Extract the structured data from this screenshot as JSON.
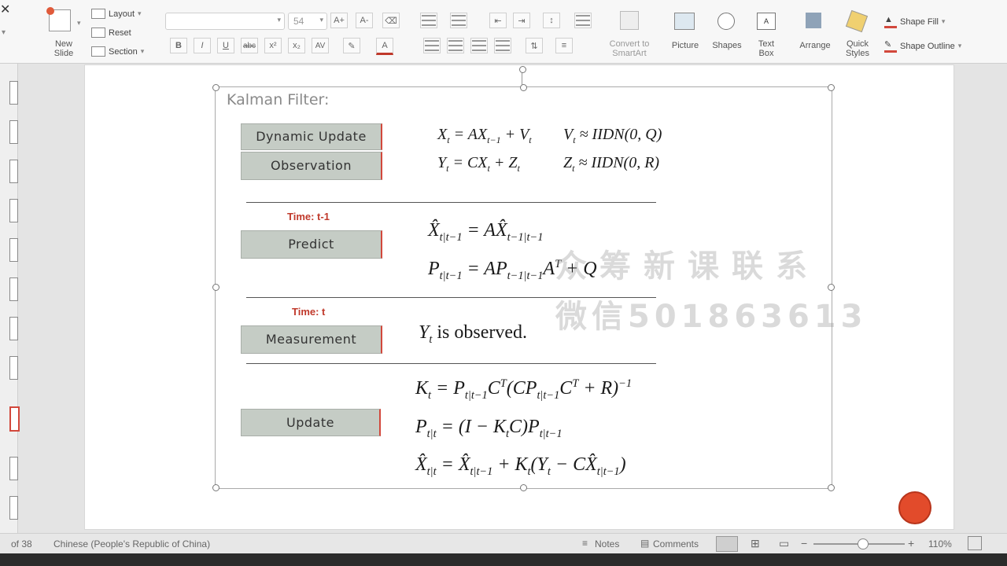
{
  "ribbon": {
    "new_slide": "New\nSlide",
    "layout": "Layout",
    "reset": "Reset",
    "section": "Section",
    "font_size": "54",
    "bold": "B",
    "italic": "I",
    "underline": "U",
    "strike": "abc",
    "superscript": "x²",
    "subscript": "x₂",
    "char_spacing": "AV",
    "font_color": "A",
    "grow": "A+",
    "shrink": "A-",
    "convert_smartart": "Convert to\nSmartArt",
    "picture": "Picture",
    "shapes": "Shapes",
    "text_box": "Text\nBox",
    "arrange": "Arrange",
    "quick_styles": "Quick\nStyles",
    "shape_fill": "Shape Fill",
    "shape_outline": "Shape Outline"
  },
  "slide": {
    "title": "Kalman Filter:",
    "boxes": {
      "dynamic_update": "Dynamic Update",
      "observation": "Observation",
      "predict": "Predict",
      "measurement": "Measurement",
      "update": "Update"
    },
    "time_prev": "Time: t-1",
    "time_curr": "Time: t",
    "observed_text": "is observed.",
    "watermark_line1": "众筹新课联系",
    "watermark_line2": "微信501863613"
  },
  "status": {
    "slide_count": "of 38",
    "language": "Chinese (People's Republic of China)",
    "notes": "Notes",
    "comments": "Comments",
    "zoom": "110%"
  },
  "colors": {
    "box_fill": "#c5ccc5",
    "time_label": "#c0392b",
    "record_button": "#e24b2b"
  }
}
